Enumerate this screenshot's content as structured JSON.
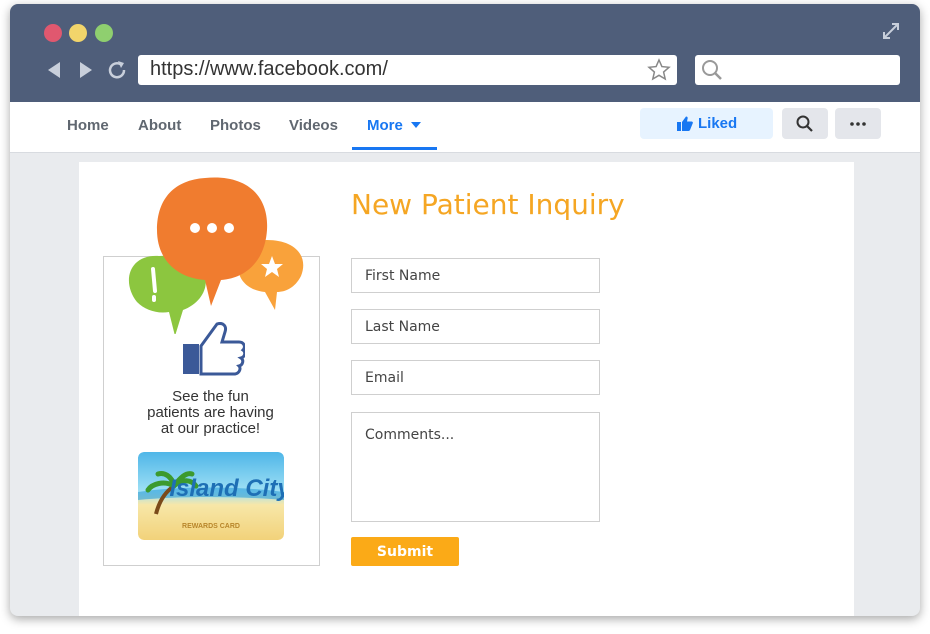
{
  "browser": {
    "url": "https://www.facebook.com/",
    "search_placeholder": ""
  },
  "fb_nav": {
    "tabs": [
      {
        "label": "Home"
      },
      {
        "label": "About"
      },
      {
        "label": "Photos"
      },
      {
        "label": "Videos"
      },
      {
        "label": "More"
      }
    ],
    "active_tab": "More",
    "liked_label": "Liked"
  },
  "promo": {
    "line1": "See the fun",
    "line2": "patients are having",
    "line3": "at our practice!",
    "card_logo": "Island City",
    "card_subtitle": "REWARDS CARD"
  },
  "form": {
    "title": "New Patient Inquiry",
    "first_name_placeholder": "First Name",
    "last_name_placeholder": "Last Name",
    "email_placeholder": "Email",
    "comments_placeholder": "Comments...",
    "submit_label": "Submit"
  },
  "colors": {
    "chrome": "#4f5e7a",
    "accent_blue": "#1877f2",
    "form_orange": "#f5a623",
    "submit": "#fbaa17"
  }
}
